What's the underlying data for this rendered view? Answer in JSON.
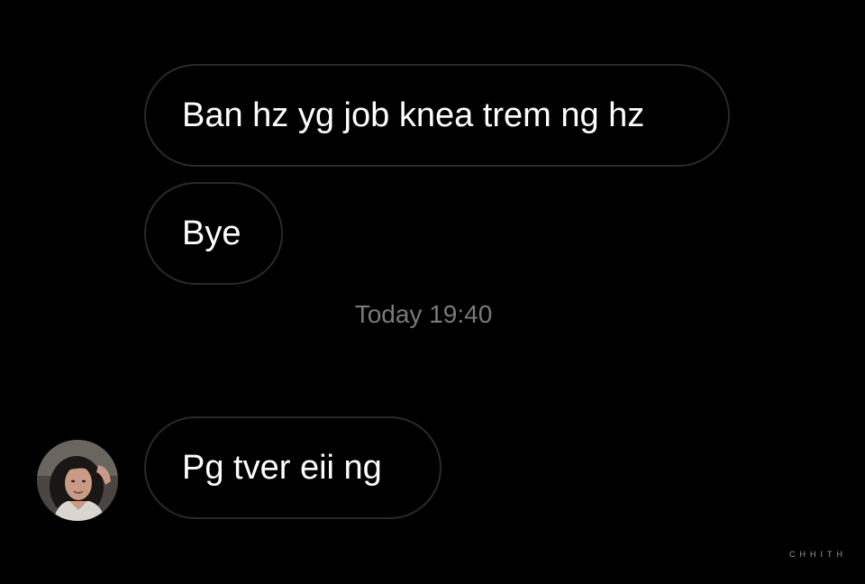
{
  "conversation": {
    "messages": [
      {
        "text": "Ban hz yg job knea trem ng hz"
      },
      {
        "text": "Bye"
      },
      {
        "text": "Pg tver eii ng"
      }
    ],
    "timestamp": "Today 19:40"
  },
  "avatar": {
    "icon": "user-avatar-photo"
  },
  "watermark": "CHHITH",
  "colors": {
    "background": "#000000",
    "bubble_border": "#2a2a2a",
    "message_text": "#ffffff",
    "timestamp_text": "#7a7a7a"
  }
}
